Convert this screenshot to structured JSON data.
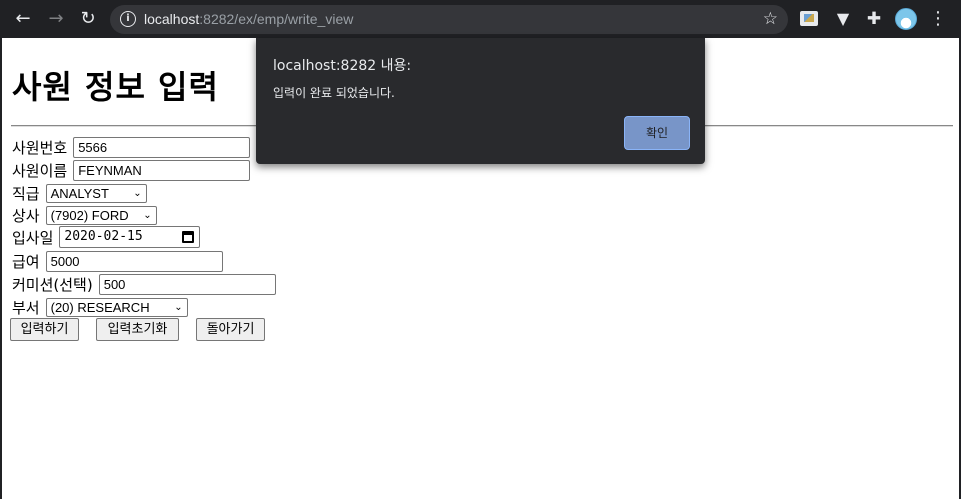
{
  "browser": {
    "url_host": "localhost",
    "url_rest": ":8282/ex/emp/write_view",
    "icons": [
      "back-arrow-icon",
      "forward-arrow-icon",
      "reload-icon",
      "info-icon",
      "star-icon",
      "image-extension-icon",
      "vee-extension-icon",
      "puzzle-icon",
      "profile-avatar",
      "more-menu-icon"
    ]
  },
  "page": {
    "title": "사원 정보 입력",
    "fields": {
      "empno": {
        "label": "사원번호",
        "value": "5566"
      },
      "ename": {
        "label": "사원이름",
        "value": "FEYNMAN"
      },
      "job": {
        "label": "직급",
        "value": "ANALYST"
      },
      "mgr": {
        "label": "상사",
        "value": "(7902) FORD"
      },
      "hiredate": {
        "label": "입사일",
        "value": "2020-02-15"
      },
      "sal": {
        "label": "급여",
        "value": "5000"
      },
      "comm": {
        "label": "커미션(선택)",
        "value": "500"
      },
      "deptno": {
        "label": "부서",
        "value": "(20) RESEARCH"
      }
    },
    "buttons": {
      "submit": "입력하기",
      "reset": "입력초기화",
      "back": "돌아가기"
    }
  },
  "dialog": {
    "title": "localhost:8282 내용:",
    "message": "입력이 완료 되었습니다.",
    "ok": "확인"
  },
  "colors": {
    "chrome": "#202124",
    "dialog_bg": "#292a2d",
    "ok_button": "#7895c8"
  }
}
